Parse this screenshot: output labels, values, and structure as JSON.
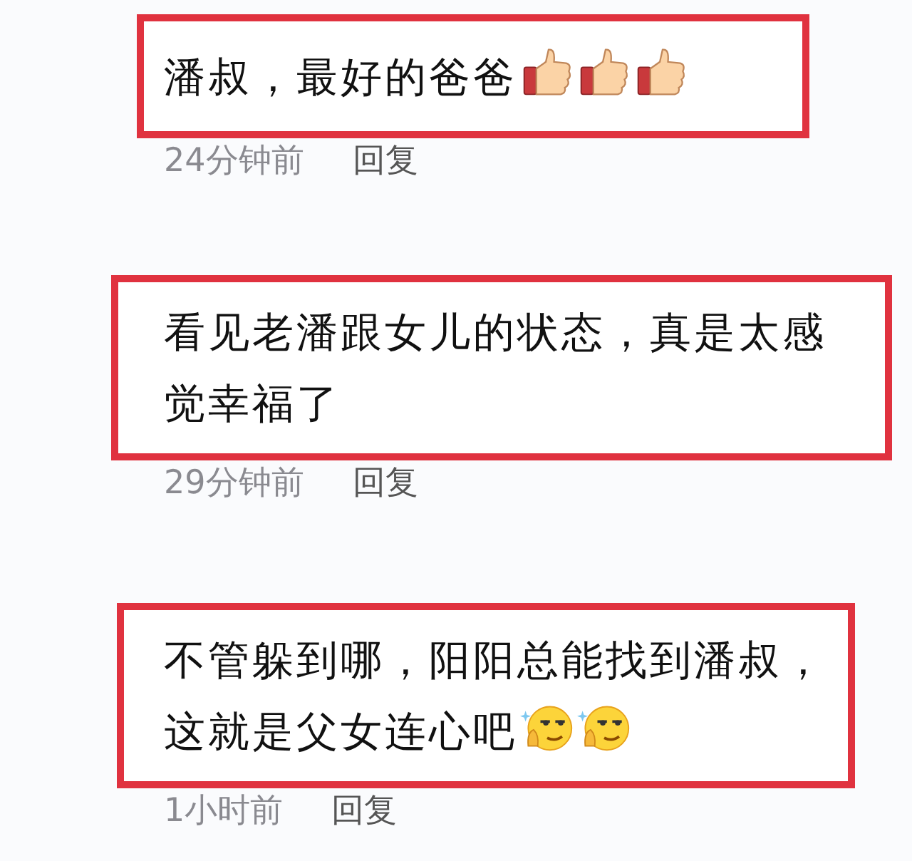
{
  "comments": [
    {
      "text": "潘叔，最好的爸爸",
      "emojis": [
        {
          "kind": "thumbs_up"
        },
        {
          "kind": "thumbs_up"
        },
        {
          "kind": "thumbs_up"
        }
      ],
      "time": "24分钟前",
      "reply": "回复"
    },
    {
      "text": "看见老潘跟女儿的状态，真是太感觉幸福了",
      "time": "29分钟前",
      "reply": "回复"
    },
    {
      "text": "不管躲到哪，阳阳总能找到潘叔，这就是父女连心吧",
      "emojis": [
        {
          "kind": "smirk"
        },
        {
          "kind": "smirk"
        }
      ],
      "time": "1小时前",
      "reply": "回复"
    }
  ]
}
